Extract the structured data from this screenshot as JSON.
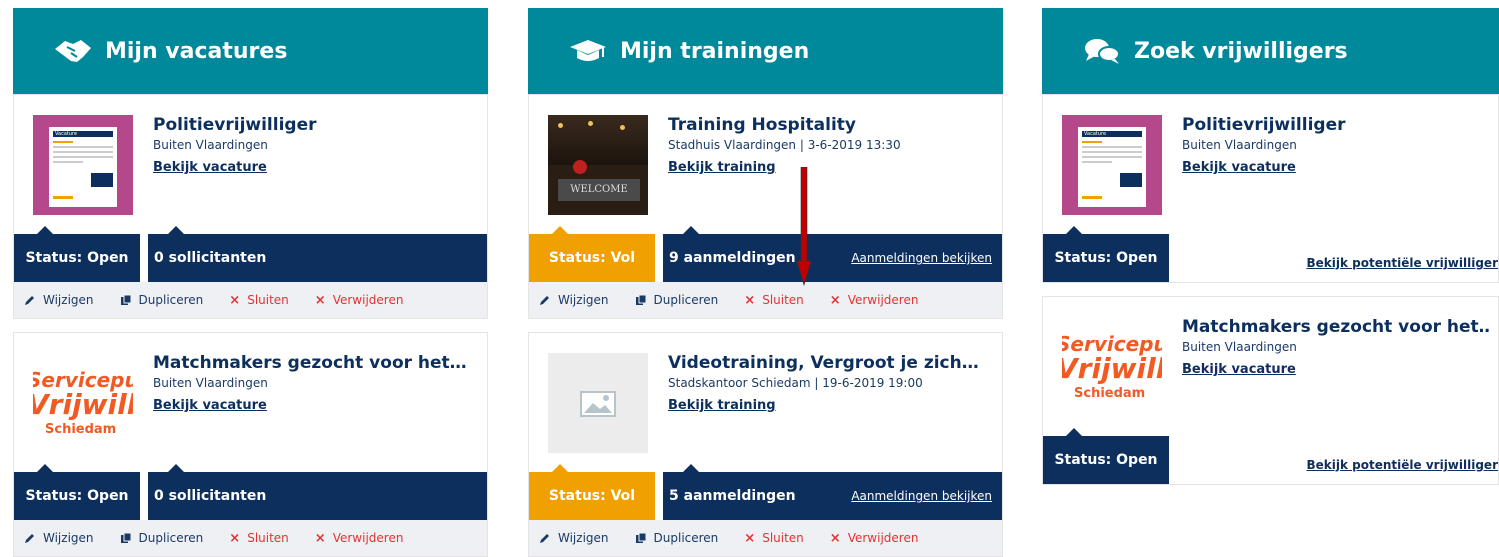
{
  "columns": [
    {
      "title": "Mijn vacatures",
      "icon": "handshake-icon",
      "cards": [
        {
          "title": "Politievrijwilliger",
          "subtitle": "Buiten Vlaardingen",
          "link": "Bekijk vacature",
          "status": "Status: Open",
          "count": "0 sollicitanten",
          "thumb": "vacature-doc"
        },
        {
          "title": "Matchmakers gezocht voor het…",
          "subtitle": "Buiten Vlaardingen",
          "link": "Bekijk vacature",
          "status": "Status: Open",
          "count": "0 sollicitanten",
          "thumb": "logo"
        }
      ],
      "actions": {
        "edit": "Wijzigen",
        "duplicate": "Dupliceren",
        "close": "Sluiten",
        "delete": "Verwijderen"
      }
    },
    {
      "title": "Mijn trainingen",
      "icon": "graduation-cap-icon",
      "cards": [
        {
          "title": "Training Hospitality",
          "subtitle": "Stadhuis Vlaardingen | 3-6-2019 13:30",
          "link": "Bekijk training",
          "status": "Status: Vol",
          "count": "9 aanmeldingen",
          "count_link": "Aanmeldingen bekijken",
          "thumb": "photo"
        },
        {
          "title": "Videotraining, Vergroot je zich…",
          "subtitle": "Stadskantoor Schiedam | 19-6-2019 19:00",
          "link": "Bekijk training",
          "status": "Status: Vol",
          "count": "5 aanmeldingen",
          "count_link": "Aanmeldingen bekijken",
          "thumb": "placeholder"
        }
      ],
      "actions": {
        "edit": "Wijzigen",
        "duplicate": "Dupliceren",
        "close": "Sluiten",
        "delete": "Verwijderen"
      }
    },
    {
      "title": "Zoek vrijwilligers",
      "icon": "chat-bubbles-icon",
      "cards": [
        {
          "title": "Politievrijwilliger",
          "subtitle": "Buiten Vlaardingen",
          "link": "Bekijk vacature",
          "status": "Status: Open",
          "potential_link": "Bekijk potentiële vrijwilliger",
          "thumb": "vacature-doc"
        },
        {
          "title": "Matchmakers gezocht voor het…",
          "subtitle": "Buiten Vlaardingen",
          "link": "Bekijk vacature",
          "status": "Status: Open",
          "potential_link": "Bekijk potentiële vrijwilliger",
          "thumb": "logo"
        }
      ]
    }
  ],
  "logo": {
    "line1": "Servicepun",
    "line2": "Vrijwillige",
    "line3": "Schiedam"
  },
  "doc_label": "Vacature",
  "thumb_photo_text": "WELCOME",
  "colors": {
    "teal": "#00889b",
    "navy": "#0d2f5e",
    "orange": "#f0a000",
    "red": "#e23333",
    "magenta": "#b5488a",
    "arrow": "#c00000"
  }
}
